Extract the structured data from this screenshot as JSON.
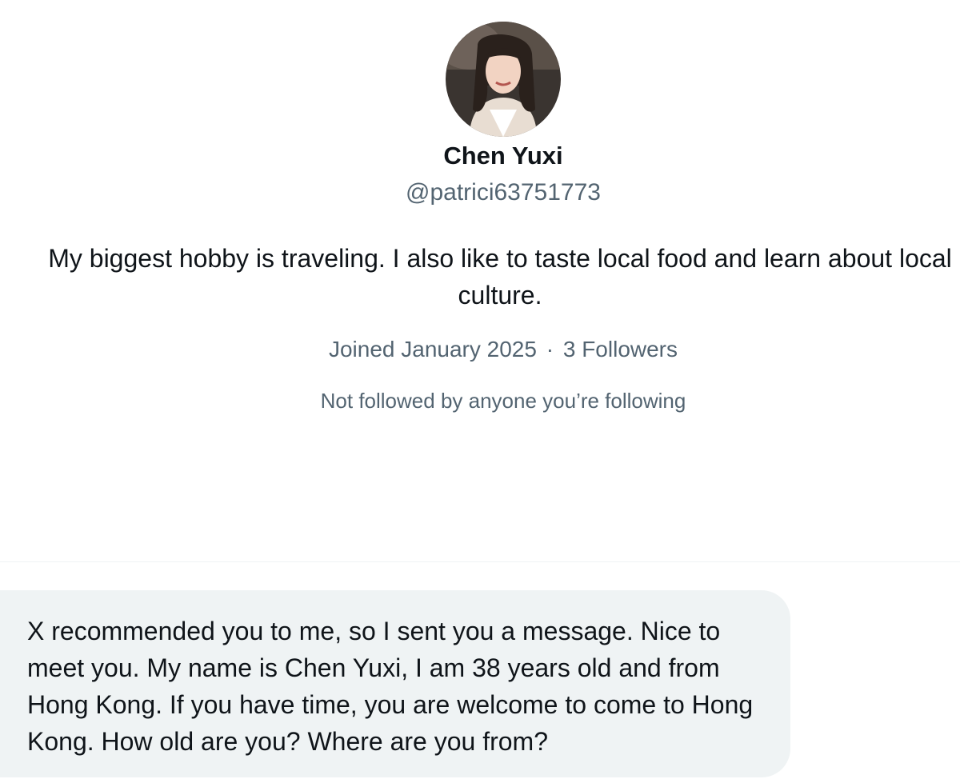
{
  "profile": {
    "avatar_icon": "profile-photo",
    "display_name": "Chen Yuxi",
    "handle": "@patrici63751773",
    "bio": "My biggest hobby is traveling. I also like to taste local food and learn about local culture.",
    "joined": "Joined January 2025",
    "separator": "·",
    "followers": "3 Followers",
    "mutual_note": "Not followed by anyone you’re following"
  },
  "conversation": {
    "messages": [
      {
        "text": "X recommended you to me, so I sent you a message. Nice to meet you. My name is Chen Yuxi, I am 38 years old and from Hong Kong. If you have time, you are welcome to come to Hong Kong. How old are you? Where are you from?"
      }
    ]
  },
  "colors": {
    "text_primary": "#0f1419",
    "text_secondary": "#536471",
    "bubble_bg": "#eff3f4"
  }
}
